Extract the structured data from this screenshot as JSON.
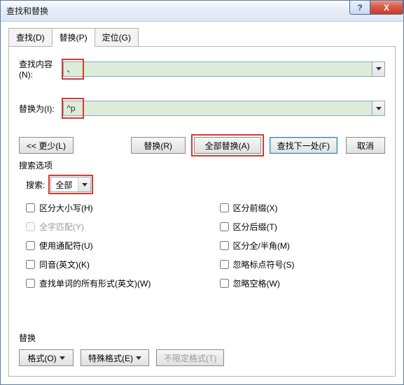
{
  "window": {
    "title": "查找和替换"
  },
  "winbtns": {
    "help": "?",
    "close": "X"
  },
  "tabs": {
    "find": "查找(D)",
    "replace": "替换(P)",
    "goto": "定位(G)"
  },
  "fields": {
    "find_label": "查找内容(N):",
    "find_value": "、",
    "replace_label": "替换为(I):",
    "replace_value": "^p"
  },
  "buttons": {
    "less": "<< 更少(L)",
    "replace": "替换(R)",
    "replace_all": "全部替换(A)",
    "find_next": "查找下一处(F)",
    "cancel": "取消"
  },
  "search_options": {
    "title": "搜索选项",
    "search_label": "搜索:",
    "direction": "全部",
    "match_case": "区分大小写(H)",
    "whole_word": "全字匹配(Y)",
    "wildcards": "使用通配符(U)",
    "sounds_like": "同音(英文)(K)",
    "all_word_forms": "查找单词的所有形式(英文)(W)",
    "match_prefix": "区分前缀(X)",
    "match_suffix": "区分后缀(T)",
    "full_half": "区分全/半角(M)",
    "ignore_punct": "忽略标点符号(S)",
    "ignore_space": "忽略空格(W)"
  },
  "bottom": {
    "title": "替换",
    "format": "格式(O)",
    "special": "特殊格式(E)",
    "no_format": "不限定格式(T)"
  }
}
